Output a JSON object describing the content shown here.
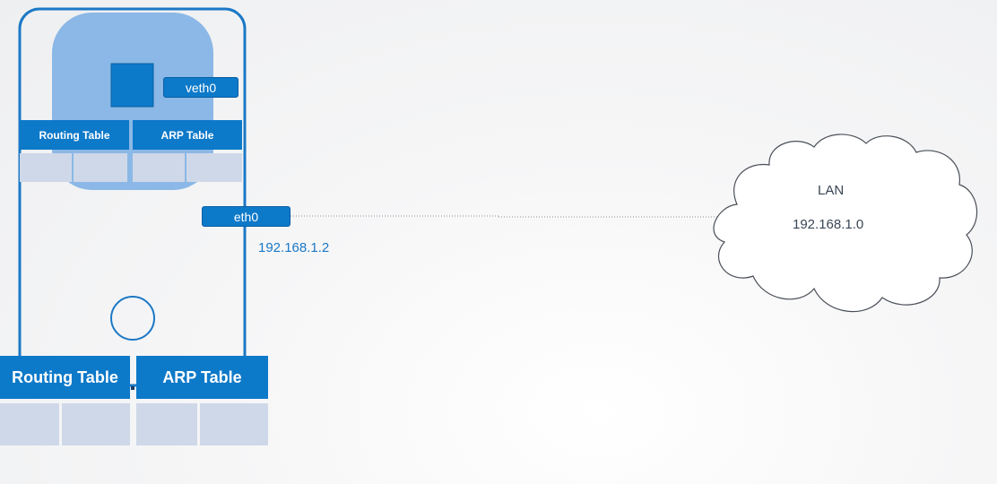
{
  "host": {
    "interface": {
      "name": "eth0",
      "ip": "192.168.1.2"
    },
    "routing_table": {
      "title": "Routing Table"
    },
    "arp_table": {
      "title": "ARP Table"
    }
  },
  "namespace": {
    "interface": {
      "name": "veth0"
    },
    "routing_table": {
      "title": "Routing Table"
    },
    "arp_table": {
      "title": "ARP Table"
    }
  },
  "lan": {
    "label": "LAN",
    "network": "192.168.1.0"
  },
  "colors": {
    "accent": "#0d79c9",
    "outline": "#1b78c6",
    "namespace_fill": "#8bb8e6",
    "table_cell": "#cfd8e8"
  }
}
